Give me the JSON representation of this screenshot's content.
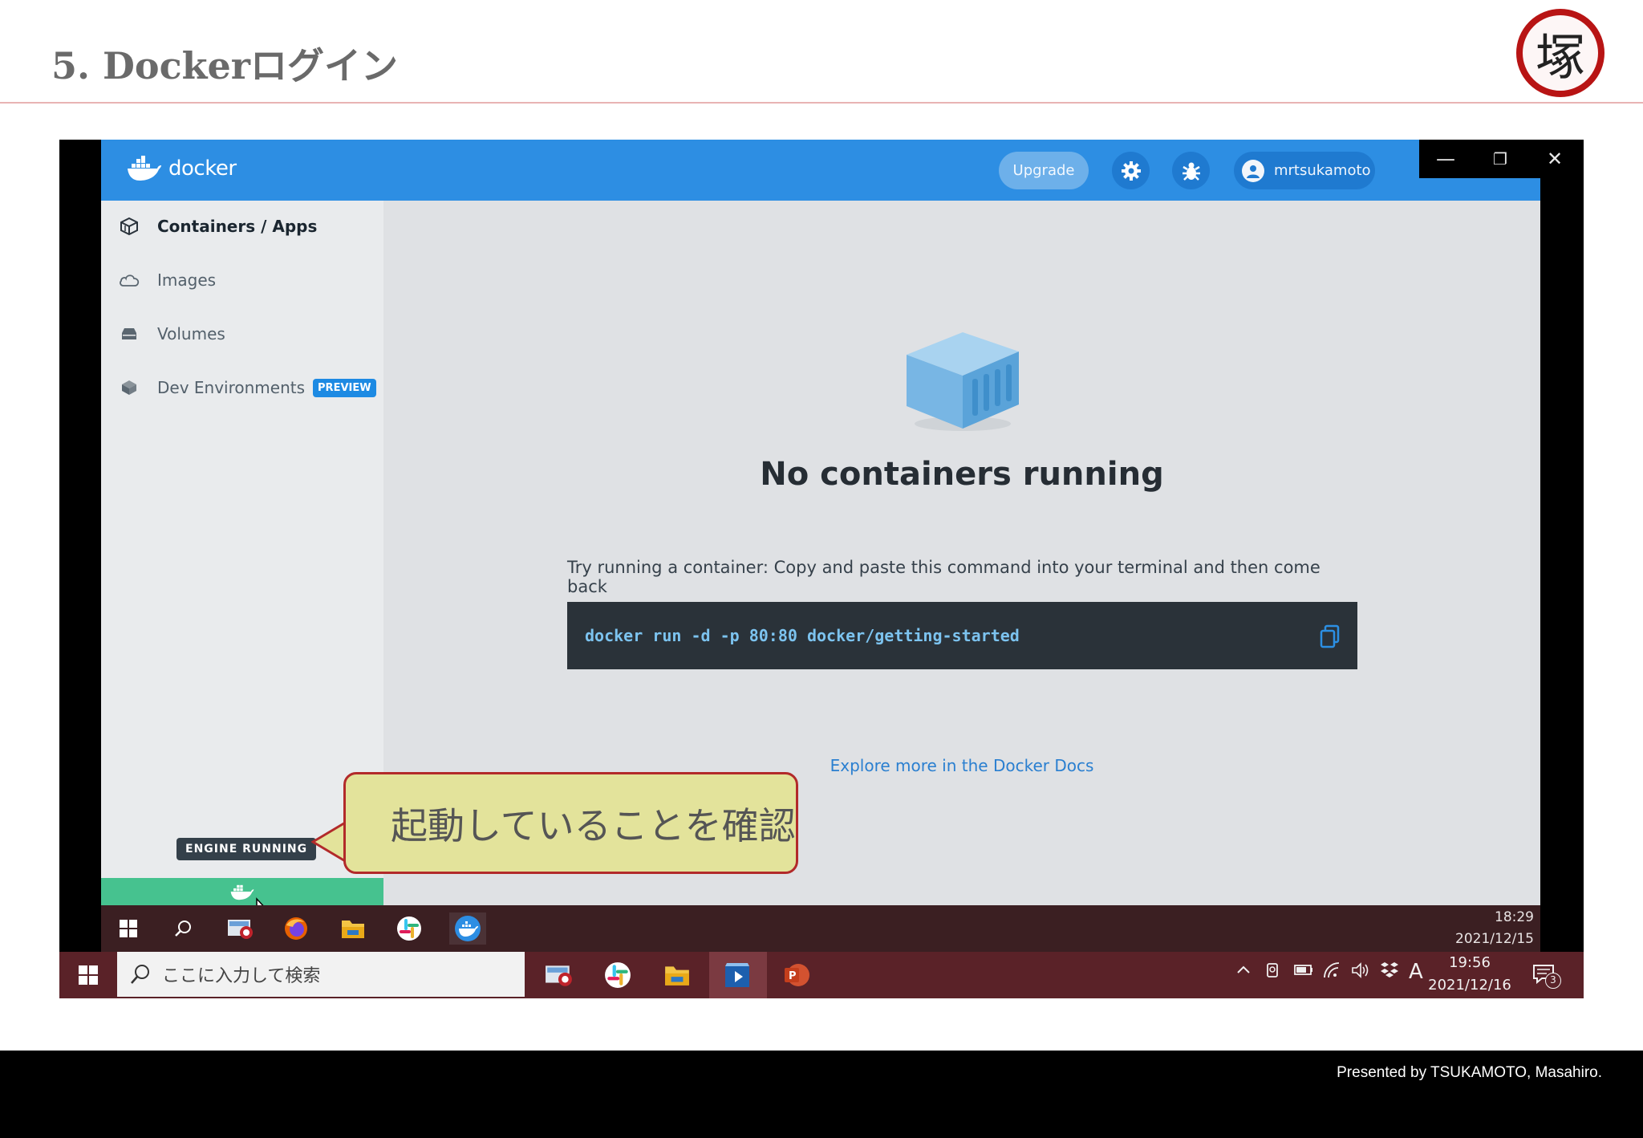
{
  "slide": {
    "title": "5. Dockerログイン",
    "seal_char": "塚",
    "footer": "Presented by TSUKAMOTO, Masahiro."
  },
  "docker": {
    "brand": "docker",
    "upgrade_label": "Upgrade",
    "username": "mrtsukamoto",
    "window_controls": {
      "minimize": "—",
      "restore": "❐",
      "close": "✕"
    },
    "sidebar": {
      "items": [
        {
          "label": "Containers / Apps",
          "icon": "container-stack-icon",
          "active": true
        },
        {
          "label": "Images",
          "icon": "cloud-icon",
          "active": false
        },
        {
          "label": "Volumes",
          "icon": "drive-icon",
          "active": false
        },
        {
          "label": "Dev Environments",
          "icon": "cubes-icon",
          "active": false,
          "badge": "PREVIEW"
        }
      ]
    },
    "main": {
      "empty_title": "No containers running",
      "try_text": "Try running a container: Copy and paste this command into your terminal and then come back",
      "command": "docker run -d -p 80:80 docker/getting-started",
      "docs_link": "Explore more in the Docker Docs"
    },
    "engine_status": "ENGINE RUNNING"
  },
  "callout": {
    "text": "起動していることを確認"
  },
  "inner_taskbar": {
    "time": "18:29",
    "date": "2021/12/15"
  },
  "outer_taskbar": {
    "search_placeholder": "ここに入力して検索",
    "ime": "A",
    "time": "19:56",
    "date": "2021/12/16",
    "notification_count": "3"
  },
  "colors": {
    "docker_blue": "#2d8ee3",
    "engine_green": "#46c28f",
    "callout_fill": "#e3e39b",
    "callout_border": "#b22a2a",
    "seal_red": "#b81414"
  }
}
